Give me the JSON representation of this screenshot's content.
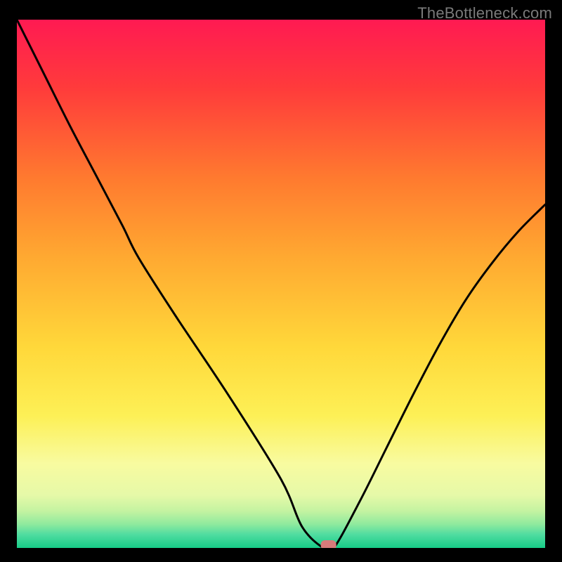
{
  "watermark": "TheBottleneck.com",
  "chart_data": {
    "type": "line",
    "title": "",
    "xlabel": "",
    "ylabel": "",
    "xlim": [
      0,
      100
    ],
    "ylim": [
      0,
      100
    ],
    "grid": false,
    "legend": false,
    "series": [
      {
        "name": "bottleneck-curve",
        "x": [
          0,
          5,
          10,
          15,
          20,
          23,
          30,
          40,
          50,
          54,
          58,
          60,
          65,
          70,
          75,
          80,
          85,
          90,
          95,
          100
        ],
        "y": [
          100,
          90,
          80,
          70.5,
          61,
          55,
          44,
          29,
          13,
          4,
          0,
          0,
          9,
          19,
          29,
          38.5,
          47,
          54,
          60,
          65
        ]
      }
    ],
    "marker": {
      "name": "optimum-marker",
      "x": 59,
      "y": 0,
      "color": "#d77b7b"
    },
    "background_gradient": {
      "stops": [
        {
          "offset": 0.0,
          "color": "#ff1a52"
        },
        {
          "offset": 0.13,
          "color": "#ff3b3b"
        },
        {
          "offset": 0.3,
          "color": "#ff7a2f"
        },
        {
          "offset": 0.45,
          "color": "#ffa931"
        },
        {
          "offset": 0.62,
          "color": "#ffd83a"
        },
        {
          "offset": 0.75,
          "color": "#fdf056"
        },
        {
          "offset": 0.84,
          "color": "#f8fba0"
        },
        {
          "offset": 0.9,
          "color": "#e6f9a8"
        },
        {
          "offset": 0.93,
          "color": "#c4f3a1"
        },
        {
          "offset": 0.955,
          "color": "#8fea9e"
        },
        {
          "offset": 0.975,
          "color": "#4fdca0"
        },
        {
          "offset": 1.0,
          "color": "#16cc87"
        }
      ]
    }
  }
}
